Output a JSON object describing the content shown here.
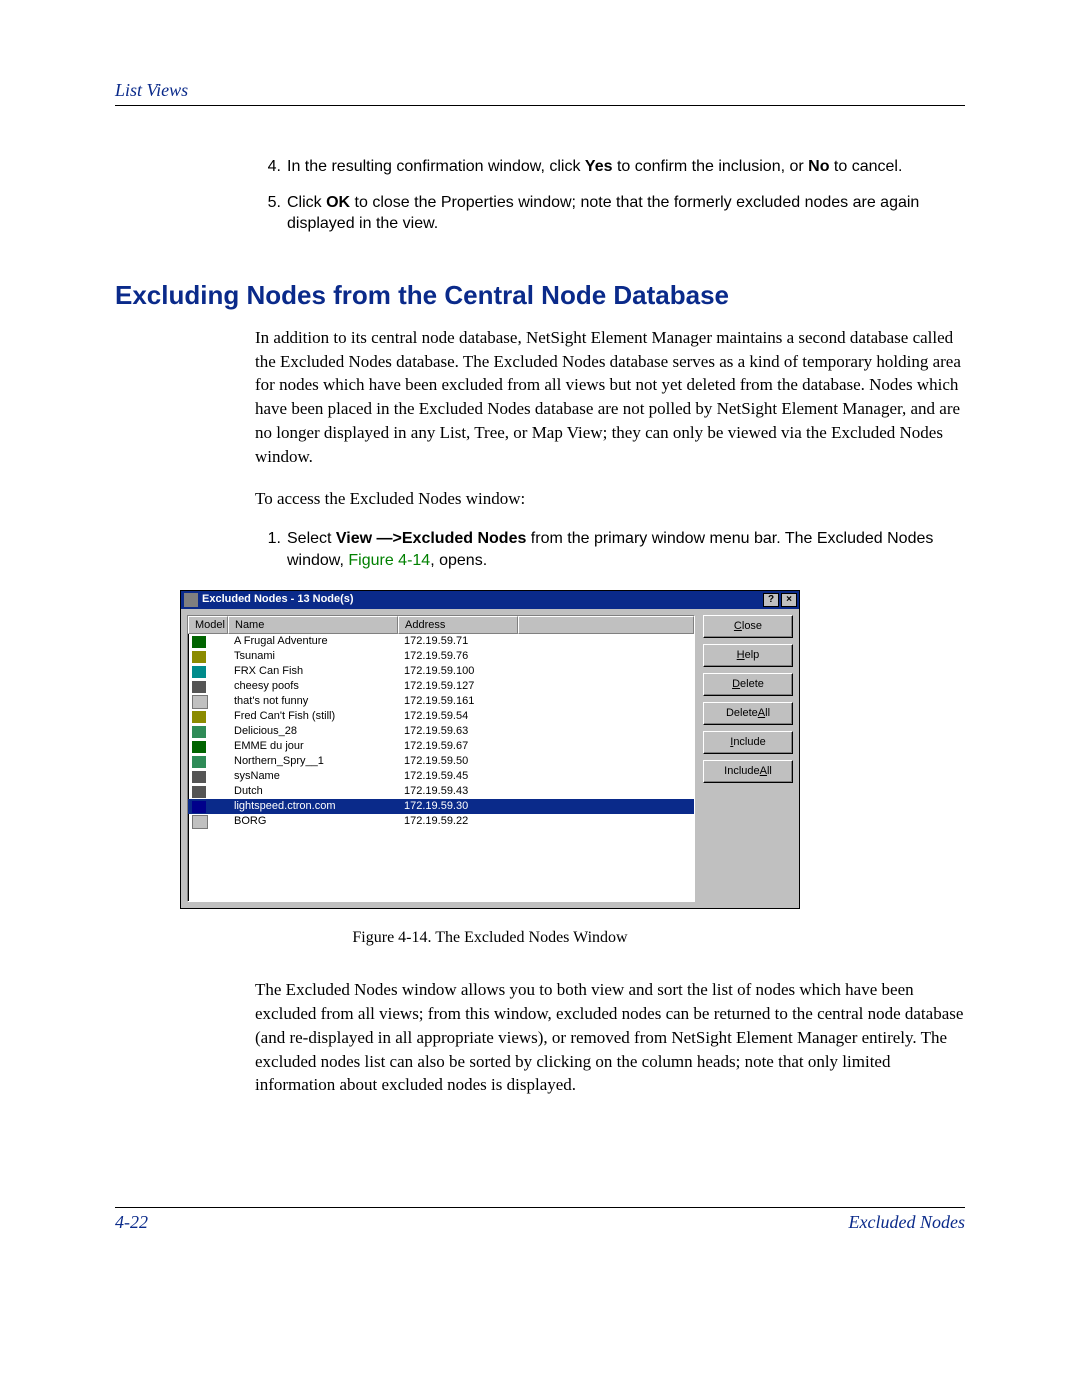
{
  "header": {
    "section_label": "List Views"
  },
  "steps_top": [
    {
      "num": "4.",
      "text_before": "In the resulting confirmation window, click ",
      "bold1": "Yes",
      "mid": " to confirm the inclusion, or ",
      "bold2": "No",
      "after": " to cancel."
    },
    {
      "num": "5.",
      "text_before": "Click ",
      "bold1": "OK",
      "mid": " to close the Properties window; note that the formerly excluded nodes are again displayed in the view.",
      "bold2": "",
      "after": ""
    }
  ],
  "section_heading": "Excluding Nodes from the Central Node Database",
  "para_intro": "In addition to its central node database, NetSight Element Manager maintains a second database called the Excluded Nodes database. The Excluded Nodes database serves as a kind of temporary holding area for nodes which have been excluded from all views but not yet deleted from the database. Nodes which have been placed in the Excluded Nodes database are not polled by NetSight Element Manager, and are no longer displayed in any List, Tree, or Map View; they can only be viewed via the Excluded Nodes window.",
  "para_access": "To access the Excluded Nodes window:",
  "step_access": {
    "num": "1.",
    "before": "Select ",
    "bold": "View —>Excluded Nodes",
    "mid": " from the primary window menu bar. The Excluded Nodes window, ",
    "figref": "Figure 4-14",
    "after": ", opens."
  },
  "dialog": {
    "title": "Excluded Nodes - 13 Node(s)",
    "help_glyph": "?",
    "close_glyph": "×",
    "columns": {
      "model": "Model",
      "name": "Name",
      "address": "Address"
    },
    "rows": [
      {
        "icon": "mi1",
        "name": "A Frugal Adventure",
        "addr": "172.19.59.71",
        "selected": false
      },
      {
        "icon": "mi2",
        "name": "Tsunami",
        "addr": "172.19.59.76",
        "selected": false
      },
      {
        "icon": "mi3",
        "name": "FRX Can Fish",
        "addr": "172.19.59.100",
        "selected": false
      },
      {
        "icon": "mi4",
        "name": "cheesy poofs",
        "addr": "172.19.59.127",
        "selected": false
      },
      {
        "icon": "mi5",
        "name": "that's not funny",
        "addr": "172.19.59.161",
        "selected": false
      },
      {
        "icon": "mi2",
        "name": "Fred Can't Fish (still)",
        "addr": "172.19.59.54",
        "selected": false
      },
      {
        "icon": "mi6",
        "name": "Delicious_28",
        "addr": "172.19.59.63",
        "selected": false
      },
      {
        "icon": "mi1",
        "name": "EMME du jour",
        "addr": "172.19.59.67",
        "selected": false
      },
      {
        "icon": "mi6",
        "name": "Northern_Spry__1",
        "addr": "172.19.59.50",
        "selected": false
      },
      {
        "icon": "mi4",
        "name": "sysName",
        "addr": "172.19.59.45",
        "selected": false
      },
      {
        "icon": "mi4",
        "name": "Dutch",
        "addr": "172.19.59.43",
        "selected": false
      },
      {
        "icon": "mi7",
        "name": "lightspeed.ctron.com",
        "addr": "172.19.59.30",
        "selected": true
      },
      {
        "icon": "mi5",
        "name": "BORG",
        "addr": "172.19.59.22",
        "selected": false
      }
    ],
    "buttons": {
      "close": {
        "pre": "",
        "u": "C",
        "post": "lose"
      },
      "help": {
        "pre": "",
        "u": "H",
        "post": "elp"
      },
      "delete": {
        "pre": "",
        "u": "D",
        "post": "elete"
      },
      "delete_all": {
        "pre": "Delete ",
        "u": "A",
        "post": "ll"
      },
      "include": {
        "pre": "",
        "u": "I",
        "post": "nclude"
      },
      "include_all": {
        "pre": "Include ",
        "u": "A",
        "post": "ll"
      }
    }
  },
  "figure_caption": "Figure 4-14. The Excluded Nodes Window",
  "para_after": "The Excluded Nodes window allows you to both view and sort the list of nodes which have been excluded from all views; from this window, excluded nodes can be returned to the central node database (and re-displayed in all appropriate views), or removed from NetSight Element Manager entirely. The excluded nodes list can also be sorted by clicking on the column heads; note that only limited information about excluded nodes is displayed.",
  "footer": {
    "page_num": "4-22",
    "section": "Excluded Nodes"
  }
}
